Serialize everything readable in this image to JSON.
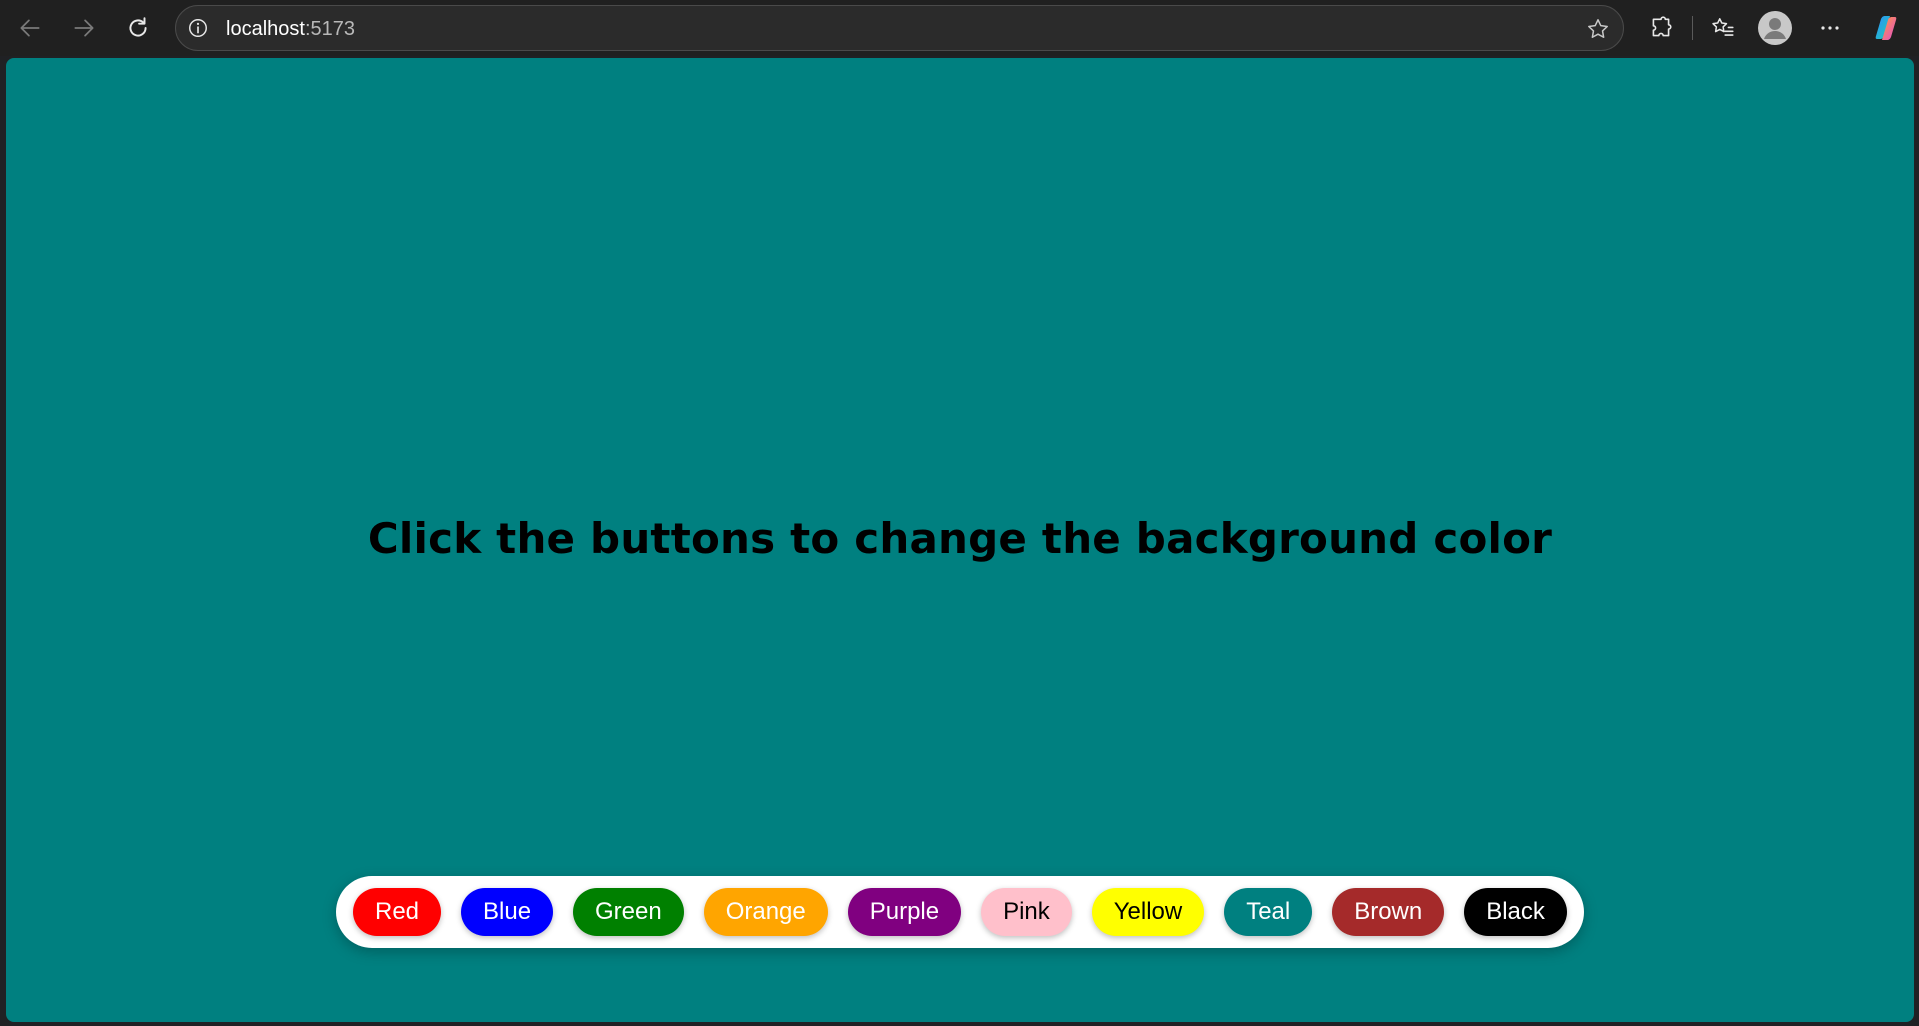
{
  "browser": {
    "url_host": "localhost",
    "url_port": ":5173",
    "icons": {
      "back": "back-arrow-icon",
      "forward": "forward-arrow-icon",
      "reload": "reload-icon",
      "site_info": "info-icon",
      "favorite": "star-icon",
      "extensions": "puzzle-icon",
      "favorites_list": "favorites-icon",
      "profile": "avatar-icon",
      "menu": "more-icon",
      "copilot": "copilot-icon"
    }
  },
  "page": {
    "background_color": "#008080",
    "heading": "Click the buttons to change the background color",
    "buttons": [
      {
        "label": "Red",
        "color": "#ff0000",
        "text_color": "#ffffff"
      },
      {
        "label": "Blue",
        "color": "#0000ff",
        "text_color": "#ffffff"
      },
      {
        "label": "Green",
        "color": "#008000",
        "text_color": "#ffffff"
      },
      {
        "label": "Orange",
        "color": "#ffa500",
        "text_color": "#ffffff"
      },
      {
        "label": "Purple",
        "color": "#800080",
        "text_color": "#ffffff"
      },
      {
        "label": "Pink",
        "color": "#ffc0cb",
        "text_color": "#000000"
      },
      {
        "label": "Yellow",
        "color": "#ffff00",
        "text_color": "#000000"
      },
      {
        "label": "Teal",
        "color": "#008080",
        "text_color": "#ffffff"
      },
      {
        "label": "Brown",
        "color": "#a52a2a",
        "text_color": "#ffffff"
      },
      {
        "label": "Black",
        "color": "#000000",
        "text_color": "#ffffff"
      }
    ]
  }
}
